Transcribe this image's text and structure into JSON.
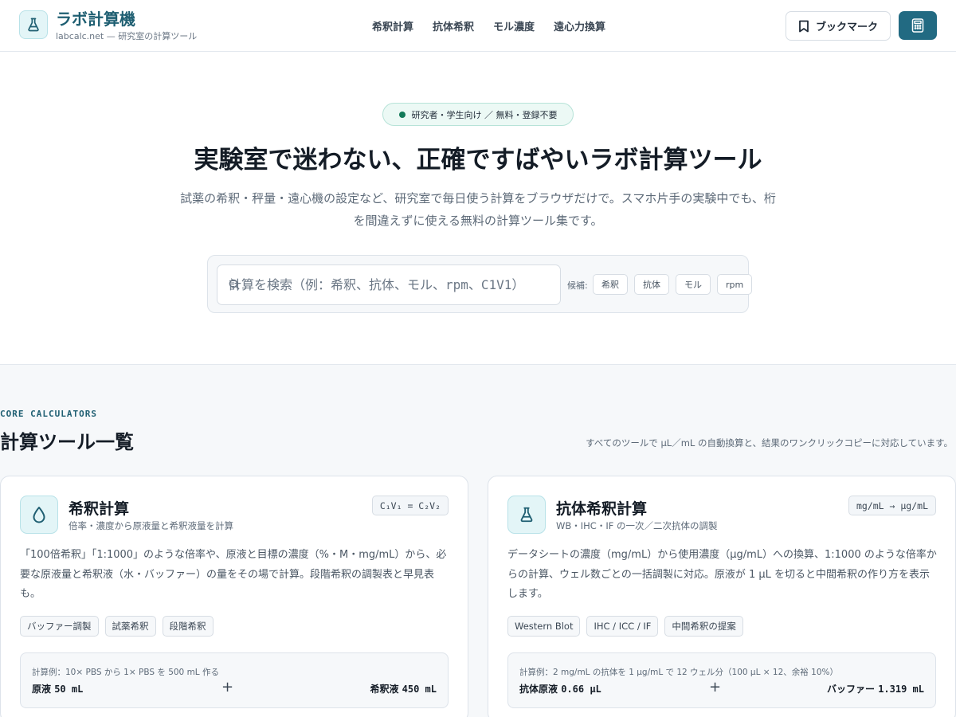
{
  "header": {
    "brand_title": "ラボ計算機",
    "brand_sub": "labcalc.net — 研究室の計算ツール",
    "nav": [
      "希釈計算",
      "抗体希釈",
      "モル濃度",
      "遠心力換算"
    ],
    "bookmark_label": "ブックマーク",
    "logo_icon": "flask-icon",
    "calc_icon": "calculator-icon"
  },
  "hero": {
    "badge": "研究者・学生向け ／ 無料・登録不要",
    "title": "実験室で迷わない、正確ですばやいラボ計算ツール",
    "description": "試薬の希釈・秤量・遠心機の設定など、研究室で毎日使う計算をブラウザだけで。スマホ片手の実験中でも、桁を間違えずに使える無料の計算ツール集です。"
  },
  "search": {
    "placeholder": "計算を検索（例：希釈、抗体、モル、rpm、C1V1）",
    "suggest_label": "候補:",
    "suggestions": [
      "希釈",
      "抗体",
      "モル",
      "rpm"
    ]
  },
  "section": {
    "eyebrow": "CORE CALCULATORS",
    "title": "計算ツール一覧",
    "note": "すべてのツールで µL／mL の自動換算と、結果のワンクリックコピーに対応しています。",
    "cards": [
      {
        "icon": "droplet-icon",
        "title": "希釈計算",
        "subtitle": "倍率・濃度から原液量と希釈液量を計算",
        "formula": "C₁V₁ = C₂V₂",
        "description": "「100倍希釈」「1:1000」のような倍率や、原液と目標の濃度（%・M・mg/mL）から、必要な原液量と希釈液（水・バッファー）の量をその場で計算。段階希釈の調製表と早見表も。",
        "tags": [
          "バッファー調製",
          "試薬希釈",
          "段階希釈"
        ],
        "example": {
          "caption": "計算例：10× PBS から 1× PBS を 500 mL 作る",
          "left_label": "原液",
          "left_value": "50 mL",
          "plus": "+",
          "right_label": "希釈液",
          "right_value": "450 mL"
        }
      },
      {
        "icon": "flask-icon",
        "title": "抗体希釈計算",
        "subtitle": "WB・IHC・IF の一次／二次抗体の調製",
        "formula": "mg/mL → µg/mL",
        "description": "データシートの濃度（mg/mL）から使用濃度（µg/mL）への換算、1:1000 のような倍率からの計算、ウェル数ごとの一括調製に対応。原液が 1 µL を切ると中間希釈の作り方を表示します。",
        "tags": [
          "Western Blot",
          "IHC / ICC / IF",
          "中間希釈の提案"
        ],
        "example": {
          "caption": "計算例：2 mg/mL の抗体を 1 µg/mL で 12 ウェル分（100 µL × 12、余裕 10%）",
          "left_label": "抗体原液",
          "left_value": "0.66 µL",
          "plus": "+",
          "right_label": "バッファー",
          "right_value": "1.319 mL"
        }
      }
    ]
  }
}
